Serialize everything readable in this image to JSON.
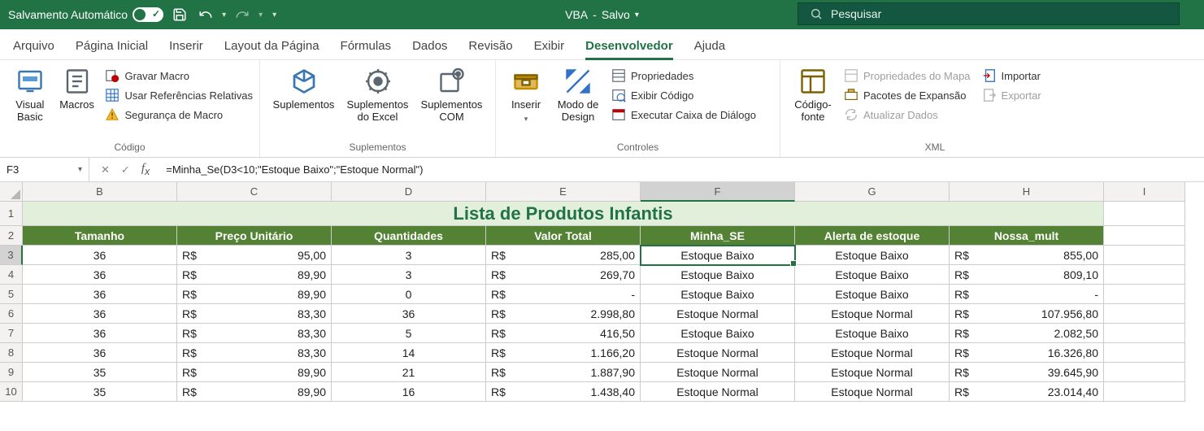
{
  "titlebar": {
    "autosave_label": "Salvamento Automático",
    "doc_name": "VBA",
    "save_state": "Salvo",
    "search_placeholder": "Pesquisar"
  },
  "tabs": [
    "Arquivo",
    "Página Inicial",
    "Inserir",
    "Layout da Página",
    "Fórmulas",
    "Dados",
    "Revisão",
    "Exibir",
    "Desenvolvedor",
    "Ajuda"
  ],
  "active_tab": "Desenvolvedor",
  "ribbon": {
    "group_code": {
      "visual_basic": "Visual\nBasic",
      "macros": "Macros",
      "record_macro": "Gravar Macro",
      "relative_refs": "Usar Referências Relativas",
      "macro_security": "Segurança de Macro",
      "label": "Código"
    },
    "group_addins": {
      "addins": "Suplementos",
      "excel_addins": "Suplementos\ndo Excel",
      "com_addins": "Suplementos\nCOM",
      "label": "Suplementos"
    },
    "group_controls": {
      "insert": "Inserir",
      "design_mode": "Modo de\nDesign",
      "properties": "Propriedades",
      "view_code": "Exibir Código",
      "run_dialog": "Executar Caixa de Diálogo",
      "label": "Controles"
    },
    "group_xml": {
      "source": "Código-\nfonte",
      "map_props": "Propriedades do Mapa",
      "expansion": "Pacotes de Expansão",
      "refresh": "Atualizar Dados",
      "import": "Importar",
      "export": "Exportar",
      "label": "XML"
    }
  },
  "formula_bar": {
    "name_box": "F3",
    "formula": "=Minha_Se(D3<10;\"Estoque Baixo\";\"Estoque Normal\")"
  },
  "grid": {
    "col_letters": [
      "B",
      "C",
      "D",
      "E",
      "F",
      "G",
      "H",
      "I"
    ],
    "row_numbers": [
      1,
      2,
      3,
      4,
      5,
      6,
      7,
      8,
      9,
      10
    ],
    "title": "Lista de Produtos Infantis",
    "headers": [
      "Tamanho",
      "Preço Unitário",
      "Quantidades",
      "Valor Total",
      "Minha_SE",
      "Alerta de estoque",
      "Nossa_mult"
    ],
    "currency": "R$",
    "rows": [
      {
        "tamanho": "36",
        "preco": "95,00",
        "qtd": "3",
        "total": "285,00",
        "minha": "Estoque Baixo",
        "alerta": "Estoque Baixo",
        "mult": "855,00"
      },
      {
        "tamanho": "36",
        "preco": "89,90",
        "qtd": "3",
        "total": "269,70",
        "minha": "Estoque Baixo",
        "alerta": "Estoque Baixo",
        "mult": "809,10"
      },
      {
        "tamanho": "36",
        "preco": "89,90",
        "qtd": "0",
        "total": "-",
        "minha": "Estoque Baixo",
        "alerta": "Estoque Baixo",
        "mult": "-"
      },
      {
        "tamanho": "36",
        "preco": "83,30",
        "qtd": "36",
        "total": "2.998,80",
        "minha": "Estoque Normal",
        "alerta": "Estoque Normal",
        "mult": "107.956,80"
      },
      {
        "tamanho": "36",
        "preco": "83,30",
        "qtd": "5",
        "total": "416,50",
        "minha": "Estoque Baixo",
        "alerta": "Estoque Baixo",
        "mult": "2.082,50"
      },
      {
        "tamanho": "36",
        "preco": "83,30",
        "qtd": "14",
        "total": "1.166,20",
        "minha": "Estoque Normal",
        "alerta": "Estoque Normal",
        "mult": "16.326,80"
      },
      {
        "tamanho": "35",
        "preco": "89,90",
        "qtd": "21",
        "total": "1.887,90",
        "minha": "Estoque Normal",
        "alerta": "Estoque Normal",
        "mult": "39.645,90"
      },
      {
        "tamanho": "35",
        "preco": "89,90",
        "qtd": "16",
        "total": "1.438,40",
        "minha": "Estoque Normal",
        "alerta": "Estoque Normal",
        "mult": "23.014,40"
      }
    ]
  }
}
